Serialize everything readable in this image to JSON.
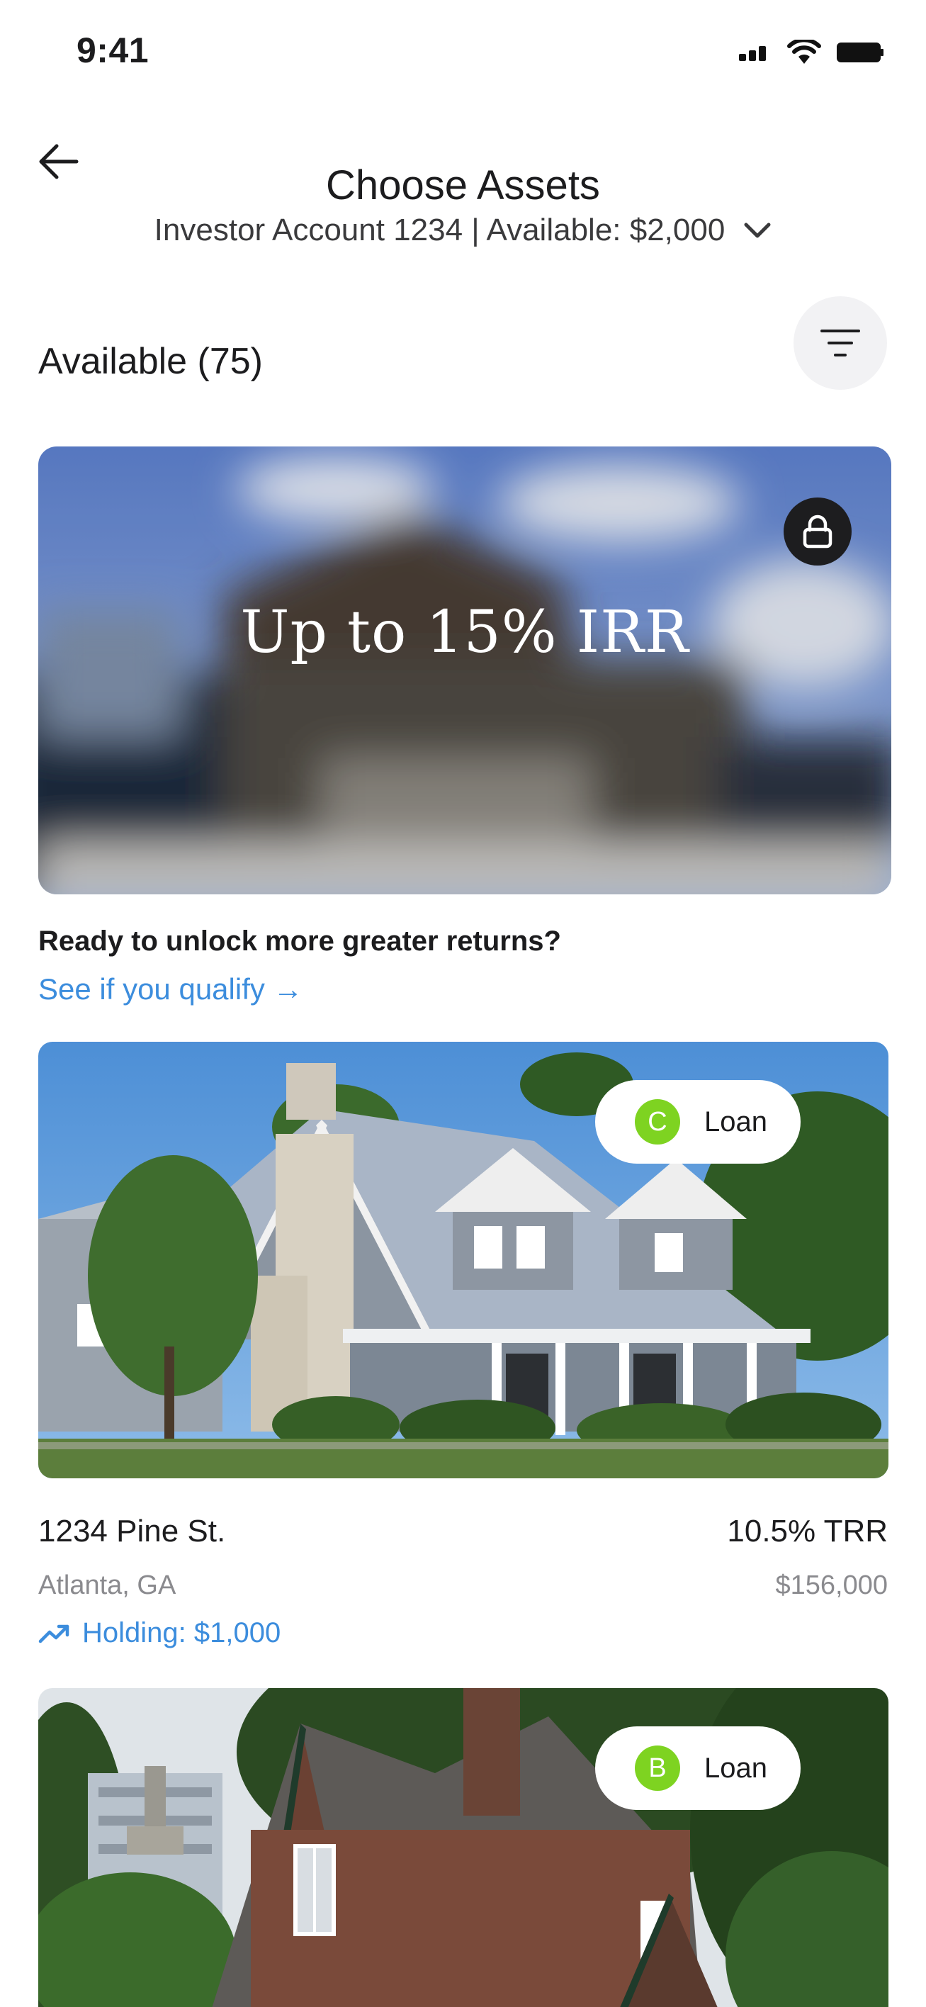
{
  "status_bar": {
    "time": "9:41"
  },
  "header": {
    "title": "Choose Assets",
    "account": "Investor Account 1234 | Available: $2,000"
  },
  "available": {
    "label": "Available (75)"
  },
  "locked_offer": {
    "title": "Up to 15% IRR",
    "prompt": "Ready to unlock more greater returns?",
    "link": "See if you qualify →"
  },
  "assets": [
    {
      "grade": "C",
      "grade_color": "#7ed321",
      "type": "Loan",
      "name": "1234 Pine St.",
      "return": "10.5% TRR",
      "location": "Atlanta, GA",
      "price": "$156,000",
      "holding": "Holding: $1,000"
    },
    {
      "grade": "B",
      "grade_color": "#7ed321",
      "type": "Loan"
    }
  ],
  "colors": {
    "accent": "#3c8ddd",
    "grade_green": "#7ed321"
  }
}
